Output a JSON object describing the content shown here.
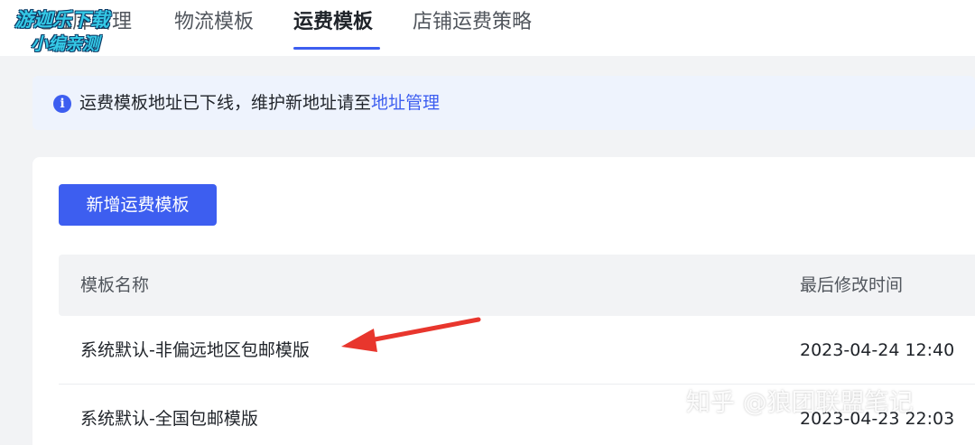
{
  "watermark_top": {
    "line1": "游迦乐下载",
    "line2": "小编亲测"
  },
  "tabs": [
    {
      "label": "地址库管理",
      "active": false
    },
    {
      "label": "物流模板",
      "active": false
    },
    {
      "label": "运费模板",
      "active": true
    },
    {
      "label": "店铺运费策略",
      "active": false
    }
  ],
  "notice": {
    "icon": "info-icon",
    "text": "运费模板地址已下线，维护新地址请至",
    "link": "地址管理"
  },
  "toolbar": {
    "add_label": "新增运费模板"
  },
  "table": {
    "columns": [
      "模板名称",
      "最后修改时间"
    ],
    "rows": [
      {
        "name": "系统默认-非偏远地区包邮模版",
        "modified": "2023-04-24 12:40"
      },
      {
        "name": "系统默认-全国包邮模版",
        "modified": "2023-04-23 22:03"
      }
    ]
  },
  "watermark_bottom": "知乎 @狼团联盟笔记",
  "colors": {
    "accent": "#3d5ef0",
    "annotation_arrow": "#e8362d"
  }
}
